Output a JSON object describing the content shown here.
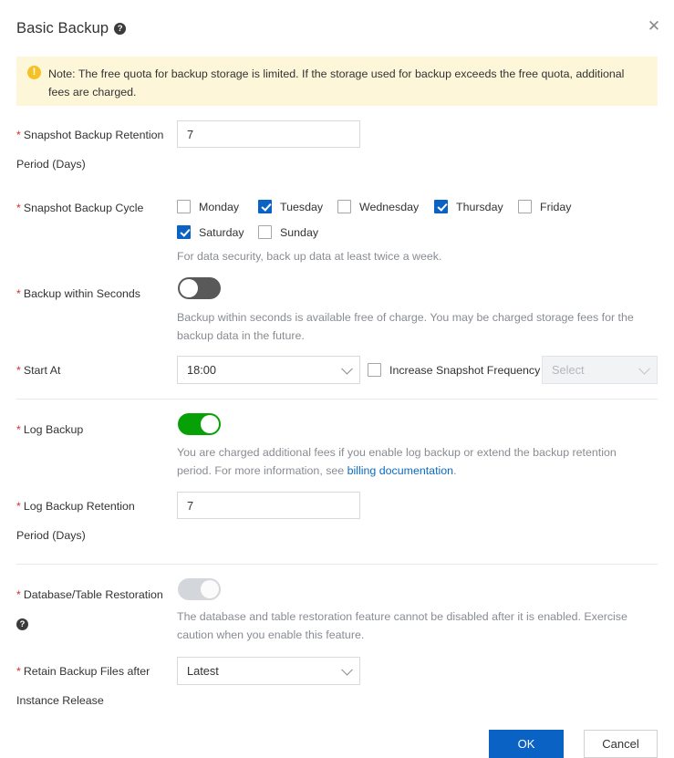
{
  "header": {
    "title": "Basic Backup",
    "help_icon": "help-circle-icon",
    "help_glyph": "?",
    "close_glyph": "✕"
  },
  "notice": {
    "icon": "warning-exclamation-icon",
    "icon_glyph": "!",
    "text": "Note: The free quota for backup storage is limited. If the storage used for backup exceeds the free quota, additional fees are charged.",
    "background": "#fdf6d9",
    "icon_color": "#f5c125"
  },
  "fields": {
    "snapshot_retention": {
      "label_line1": "Snapshot Backup Retention",
      "label_line2": "Period (Days)",
      "required": "*",
      "value": "7"
    },
    "snapshot_cycle": {
      "label": "Snapshot Backup Cycle",
      "required": "*",
      "days": [
        {
          "label": "Monday",
          "checked": false
        },
        {
          "label": "Tuesday",
          "checked": true
        },
        {
          "label": "Wednesday",
          "checked": false
        },
        {
          "label": "Thursday",
          "checked": true
        },
        {
          "label": "Friday",
          "checked": false
        },
        {
          "label": "Saturday",
          "checked": true
        },
        {
          "label": "Sunday",
          "checked": false
        }
      ],
      "hint": "For data security, back up data at least twice a week."
    },
    "backup_within_seconds": {
      "label": "Backup within Seconds",
      "required": "*",
      "toggle_state": "off",
      "hint": "Backup within seconds is available free of charge. You may be charged storage fees for the backup data in the future."
    },
    "start_at": {
      "label": "Start At",
      "required": "*",
      "value": "18:00",
      "increase_frequency_label": "Increase Snapshot Frequency",
      "increase_frequency_checked": false,
      "frequency_placeholder": "Select",
      "frequency_disabled": true
    },
    "log_backup": {
      "label": "Log Backup",
      "required": "*",
      "toggle_state": "on",
      "hint_part1": "You are charged additional fees if you enable log backup or extend the backup retention period. For more information, see ",
      "hint_link": "billing documentation",
      "hint_part2": "."
    },
    "log_backup_retention": {
      "label_line1": "Log Backup Retention",
      "label_line2": "Period (Days)",
      "required": "*",
      "value": "7"
    },
    "db_table_restoration": {
      "label": "Database/Table Restoration",
      "required": "*",
      "help_icon": "help-circle-icon",
      "help_glyph": "?",
      "toggle_state": "disabled",
      "hint": "The database and table restoration feature cannot be disabled after it is enabled. Exercise caution when you enable this feature."
    },
    "retain_backup_files": {
      "label_line1": "Retain Backup Files after",
      "label_line2": "Instance Release",
      "required": "*",
      "value": "Latest"
    }
  },
  "footer": {
    "ok_label": "OK",
    "cancel_label": "Cancel",
    "primary_color": "#0a63c4"
  }
}
